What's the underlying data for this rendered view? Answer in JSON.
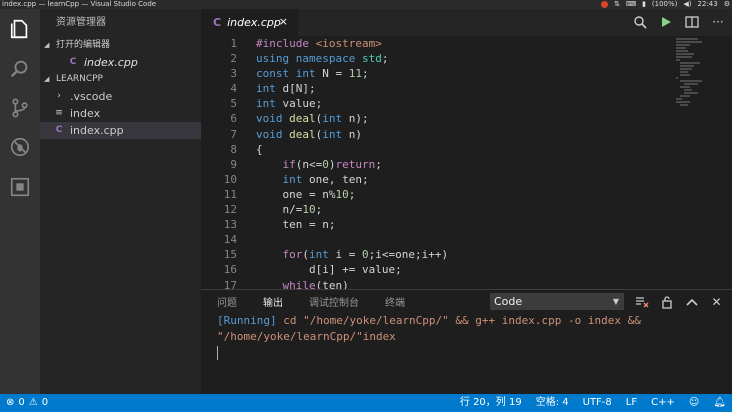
{
  "os": {
    "window_title": "index.cpp — learnCpp — Visual Studio Code",
    "tray": {
      "battery": "(100%)",
      "volume_icon": "volume-icon",
      "clock": "22:43"
    }
  },
  "sidebar": {
    "title": "资源管理器",
    "open_editors_label": "打开的编辑器",
    "open_editors": [
      {
        "name": "index.cpp",
        "icon": "cpp-file-icon"
      }
    ],
    "folder_label": "LEARNCPP",
    "tree": [
      {
        "name": ".vscode",
        "icon": "chevron-right-icon",
        "active": false
      },
      {
        "name": "index",
        "icon": "binary-file-icon",
        "active": false
      },
      {
        "name": "index.cpp",
        "icon": "cpp-file-icon",
        "active": true
      }
    ]
  },
  "editor": {
    "tab": {
      "name": "index.cpp",
      "close": "×"
    },
    "line_numbers": [
      "1",
      "2",
      "3",
      "4",
      "5",
      "6",
      "7",
      "8",
      "9",
      "10",
      "11",
      "12",
      "13",
      "14",
      "15",
      "16",
      "17"
    ]
  },
  "panel": {
    "tabs": [
      {
        "label": "问题",
        "active": false
      },
      {
        "label": "输出",
        "active": true
      },
      {
        "label": "调试控制台",
        "active": false
      },
      {
        "label": "终端",
        "active": false
      }
    ],
    "select_value": "Code",
    "output_running": "[Running]",
    "output_cmd": " cd \"/home/yoke/learnCpp/\" && g++ index.cpp -o index && \"/home/yoke/learnCpp/\"index"
  },
  "statusbar": {
    "errors": "0",
    "warnings": "0",
    "position": "行 20，列 19",
    "spaces": "空格: 4",
    "encoding": "UTF-8",
    "eol": "LF",
    "language": "C++"
  },
  "colors": {
    "accent": "#007acc",
    "keyword": "#569cd6",
    "string": "#ce9178",
    "number": "#b5cea8",
    "function": "#dcdcaa",
    "control": "#c586c0"
  }
}
